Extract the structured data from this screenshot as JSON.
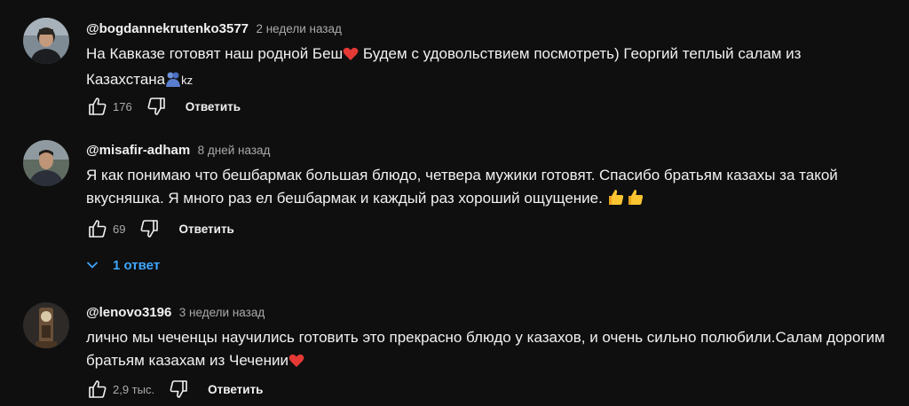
{
  "comments": [
    {
      "author": "@bogdannekrutenko3577",
      "time": "2 недели назад",
      "text_line1_a": "На Кавказе готовят наш родной Беш",
      "text_line1_b": " Будем с удовольствием посмотреть) Георгий теплый салам из",
      "text_line2_a": "Казахстана",
      "text_line2_b": "kz",
      "likes": "176",
      "reply_label": "Ответить"
    },
    {
      "author": "@misafir-adham",
      "time": "8 дней назад",
      "text_line1": "Я как понимаю что бешбармак большая блюдо, четвера мужики готовят. Спасибо братьям казахы за такой",
      "text_line2": "вкусняшка. Я много раз ел бешбармак и каждый раз хороший ощущение. ",
      "likes": "69",
      "reply_label": "Ответить",
      "replies_label": "1 ответ"
    },
    {
      "author": "@lenovo3196",
      "time": "3 недели назад",
      "text_line1": "лично мы чеченцы научились готовить это прекрасно блюдо у казахов, и очень сильно полюбили.Салам дорогим",
      "text_line2": "братьям казахам из Чечении",
      "likes": "2,9 тыс.",
      "reply_label": "Ответить"
    }
  ],
  "colors": {
    "background": "#0f0f0f",
    "text_primary": "#f1f1f1",
    "text_secondary": "#aaaaaa",
    "link": "#3ea6ff",
    "heart": "#e53935"
  },
  "icons": [
    "like-icon",
    "dislike-icon",
    "chevron-down-icon",
    "heart-emoji",
    "hug-emoji",
    "thumbs-up-emoji"
  ]
}
